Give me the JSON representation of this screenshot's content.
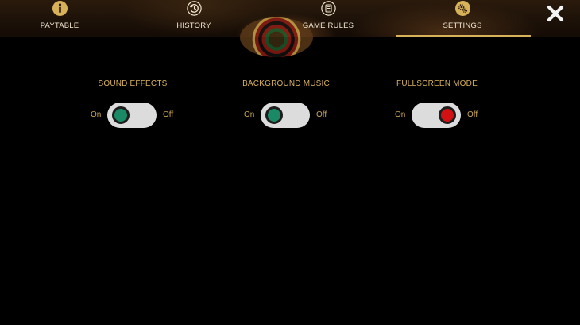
{
  "nav": {
    "tabs": [
      {
        "label": "PAYTABLE",
        "icon": "info-icon"
      },
      {
        "label": "HISTORY",
        "icon": "history-icon"
      },
      {
        "label": "GAME RULES",
        "icon": "rules-scroll-icon"
      },
      {
        "label": "SETTINGS",
        "icon": "gears-icon",
        "active": true
      }
    ],
    "close_icon": "close-icon"
  },
  "settings": [
    {
      "title": "SOUND EFFECTS",
      "on_label": "On",
      "off_label": "Off",
      "state": "on",
      "knob_color": "#1a8a66"
    },
    {
      "title": "BACKGROUND MUSIC",
      "on_label": "On",
      "off_label": "Off",
      "state": "on",
      "knob_color": "#1a8a66"
    },
    {
      "title": "FULLSCREEN MODE",
      "on_label": "On",
      "off_label": "Off",
      "state": "off",
      "knob_color": "#d21212"
    }
  ],
  "colors": {
    "accent": "#d8b25a",
    "tab_text": "#f1e6cf",
    "toggle_track": "#dcdcdc",
    "background": "#000000"
  }
}
